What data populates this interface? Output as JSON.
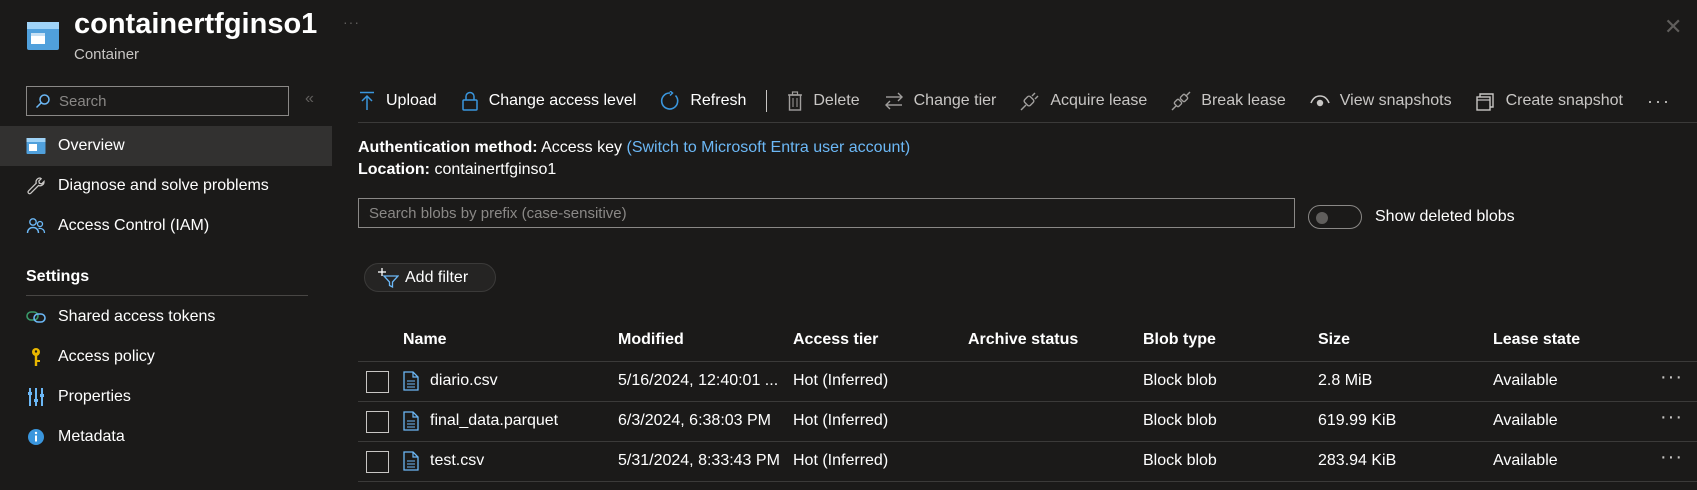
{
  "header": {
    "title": "containertfginso1",
    "subtitle": "Container",
    "more": "···",
    "close": "✕"
  },
  "sidebar": {
    "search_placeholder": "Search",
    "collapse": "«",
    "items": [
      {
        "label": "Overview",
        "icon": "container-icon"
      },
      {
        "label": "Diagnose and solve problems",
        "icon": "wrench-icon"
      },
      {
        "label": "Access Control (IAM)",
        "icon": "people-icon"
      }
    ],
    "settings_title": "Settings",
    "settings_items": [
      {
        "label": "Shared access tokens",
        "icon": "link-icon"
      },
      {
        "label": "Access policy",
        "icon": "key-icon"
      },
      {
        "label": "Properties",
        "icon": "properties-icon"
      },
      {
        "label": "Metadata",
        "icon": "info-icon"
      }
    ]
  },
  "toolbar": {
    "upload": "Upload",
    "change_access": "Change access level",
    "refresh": "Refresh",
    "delete": "Delete",
    "change_tier": "Change tier",
    "acquire_lease": "Acquire lease",
    "break_lease": "Break lease",
    "view_snapshots": "View snapshots",
    "create_snapshot": "Create snapshot",
    "more": "···"
  },
  "info": {
    "auth_label": "Authentication method:",
    "auth_value": "Access key",
    "auth_link": "(Switch to Microsoft Entra user account)",
    "location_label": "Location:",
    "location_value": "containertfginso1"
  },
  "search": {
    "placeholder": "Search blobs by prefix (case-sensitive)"
  },
  "toggle": {
    "label": "Show deleted blobs"
  },
  "filter": {
    "label": "Add filter"
  },
  "table": {
    "headers": {
      "name": "Name",
      "modified": "Modified",
      "access_tier": "Access tier",
      "archive_status": "Archive status",
      "blob_type": "Blob type",
      "size": "Size",
      "lease_state": "Lease state"
    },
    "rows": [
      {
        "name": "diario.csv",
        "modified": "5/16/2024, 12:40:01 ...",
        "access_tier": "Hot (Inferred)",
        "archive_status": "",
        "blob_type": "Block blob",
        "size": "2.8 MiB",
        "lease_state": "Available",
        "more": "···"
      },
      {
        "name": "final_data.parquet",
        "modified": "6/3/2024, 6:38:03 PM",
        "access_tier": "Hot (Inferred)",
        "archive_status": "",
        "blob_type": "Block blob",
        "size": "619.99 KiB",
        "lease_state": "Available",
        "more": "···"
      },
      {
        "name": "test.csv",
        "modified": "5/31/2024, 8:33:43 PM",
        "access_tier": "Hot (Inferred)",
        "archive_status": "",
        "blob_type": "Block blob",
        "size": "283.94 KiB",
        "lease_state": "Available",
        "more": "···"
      }
    ]
  },
  "colors": {
    "background": "#1b1a19",
    "accent": "#3a96dd",
    "link": "#6cb8f6",
    "active_nav": "#323130"
  }
}
